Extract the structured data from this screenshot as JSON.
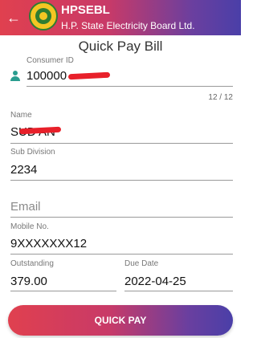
{
  "header": {
    "back_icon": "arrow-left-icon",
    "title": "HPSEBL",
    "subtitle": "H.P. State Electricity Board Ltd."
  },
  "page": {
    "title": "Quick Pay Bill"
  },
  "form": {
    "consumer_id": {
      "label": "Consumer ID",
      "value": "100000",
      "icon": "person-icon",
      "counter": "12 / 12"
    },
    "name": {
      "label": "Name",
      "value": "SUD AN"
    },
    "sub_division": {
      "label": "Sub Division",
      "value": "2234"
    },
    "email": {
      "placeholder": "Email"
    },
    "mobile": {
      "label": "Mobile No.",
      "value": "9XXXXXXX12"
    },
    "outstanding": {
      "label": "Outstanding",
      "value": "379.00"
    },
    "due_date": {
      "label": "Due Date",
      "value": "2022-04-25"
    }
  },
  "actions": {
    "quick_pay_label": "QUICK PAY"
  },
  "colors": {
    "gradient_start": "#e0404f",
    "gradient_end": "#4a3fa8",
    "icon_accent": "#2a9d8f",
    "redaction": "#e8202a"
  }
}
